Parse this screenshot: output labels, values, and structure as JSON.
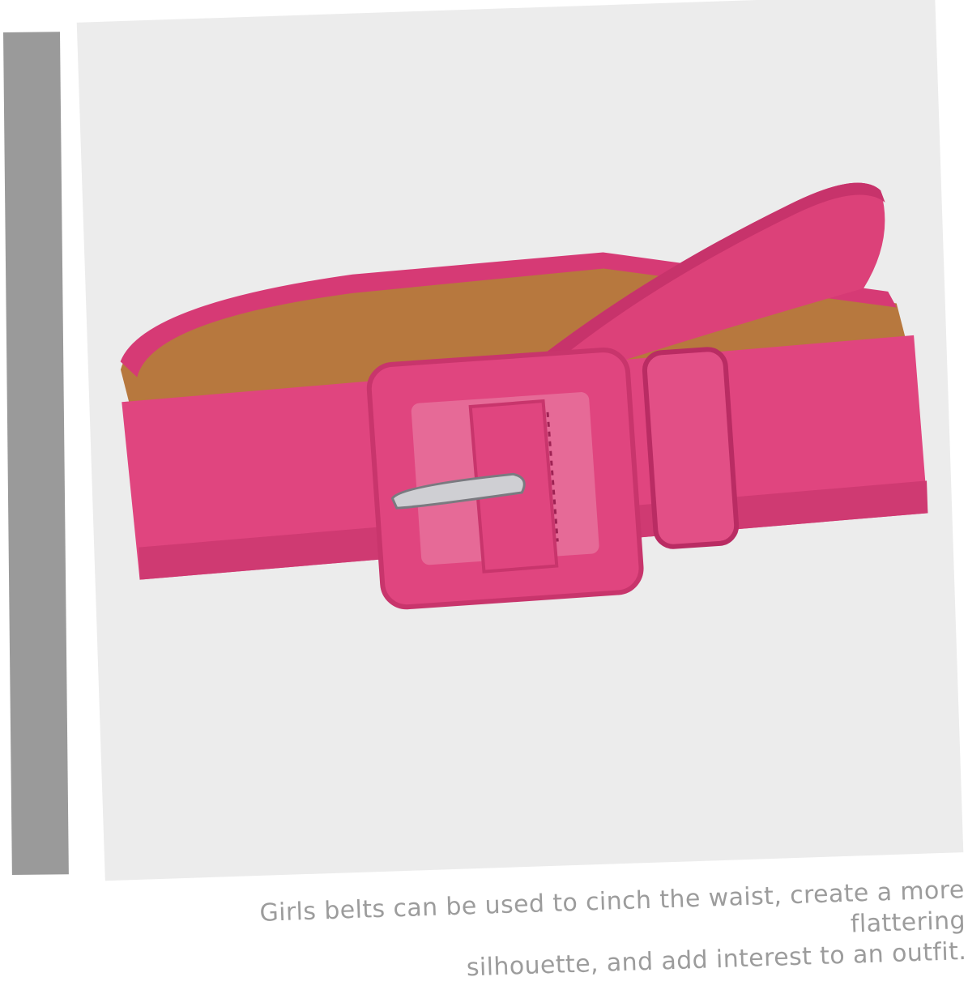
{
  "caption": {
    "line1": "Girls belts can be used to cinch the waist, create a more flattering",
    "line2": "silhouette, and add interest to an outfit."
  },
  "colors": {
    "belt_pink": "#e0457f",
    "belt_dark": "#b92c63",
    "belt_inner": "#b7783e",
    "background": "#ececec",
    "side_bar": "#9a9a9a",
    "caption_text": "#9c9c9c"
  },
  "image": {
    "subject": "pink-leather-belt-with-square-buckle"
  }
}
